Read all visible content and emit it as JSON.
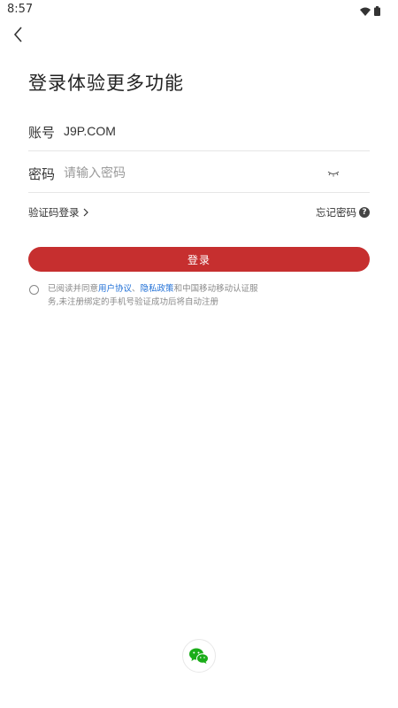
{
  "status_bar": {
    "time": "8:57"
  },
  "page": {
    "title": "登录体验更多功能"
  },
  "form": {
    "account_label": "账号",
    "account_value": "J9P.COM",
    "password_label": "密码",
    "password_placeholder": "请输入密码"
  },
  "links": {
    "sms_login": "验证码登录",
    "forgot_password": "忘记密码"
  },
  "login_button": "登录",
  "agreement": {
    "prefix": "已阅读并同意",
    "user_agreement": "用户协议",
    "separator": "、",
    "privacy_policy": "隐私政策",
    "suffix": "和中国移动移动认证服务,未注册绑定的手机号验证成功后将自动注册"
  },
  "colors": {
    "primary": "#c62f2f",
    "link": "#1f6fd6",
    "wechat": "#1aad19"
  }
}
